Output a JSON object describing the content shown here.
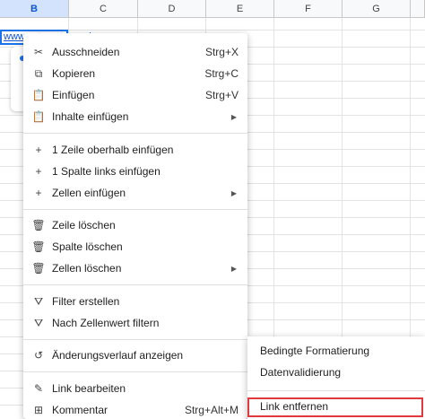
{
  "sheet": {
    "columns": [
      "B",
      "C",
      "D",
      "E",
      "F",
      "G"
    ],
    "selected_column": "B",
    "cell_value": "www.automateexcel.com"
  },
  "menu": {
    "items": [
      {
        "icon": "scissors-icon",
        "glyph": "✂",
        "label": "Ausschneiden",
        "shortcut": "Strg+X"
      },
      {
        "icon": "copy-icon",
        "glyph": "⧉",
        "label": "Kopieren",
        "shortcut": "Strg+C"
      },
      {
        "icon": "clipboard-icon",
        "glyph": "📋",
        "label": "Einfügen",
        "shortcut": "Strg+V"
      },
      {
        "icon": "clipboard-icon",
        "glyph": "📋",
        "label": "Inhalte einfügen",
        "submenu": true
      },
      {
        "icon": "plus-icon",
        "glyph": "+",
        "label": "1 Zeile oberhalb einfügen"
      },
      {
        "icon": "plus-icon",
        "glyph": "+",
        "label": "1 Spalte links einfügen"
      },
      {
        "icon": "plus-icon",
        "glyph": "+",
        "label": "Zellen einfügen",
        "submenu": true
      },
      {
        "icon": "trash-icon",
        "glyph": "🗑",
        "label": "Zeile löschen"
      },
      {
        "icon": "trash-icon",
        "glyph": "🗑",
        "label": "Spalte löschen"
      },
      {
        "icon": "trash-icon",
        "glyph": "🗑",
        "label": "Zellen löschen",
        "submenu": true
      },
      {
        "icon": "filter-icon",
        "glyph": "⛛",
        "label": "Filter erstellen"
      },
      {
        "icon": "filter-icon",
        "glyph": "⛛",
        "label": "Nach Zellenwert filtern"
      },
      {
        "icon": "history-icon",
        "glyph": "↺",
        "label": "Änderungsverlauf anzeigen"
      },
      {
        "icon": "pencil-icon",
        "glyph": "✎",
        "label": "Link bearbeiten"
      },
      {
        "icon": "comment-icon",
        "glyph": "⊞",
        "label": "Kommentar",
        "shortcut": "Strg+Alt+M"
      }
    ]
  },
  "submenu": {
    "items": [
      "Bedingte Formatierung",
      "Datenvalidierung",
      "Link entfernen"
    ],
    "highlight_color": "#e0393e"
  }
}
